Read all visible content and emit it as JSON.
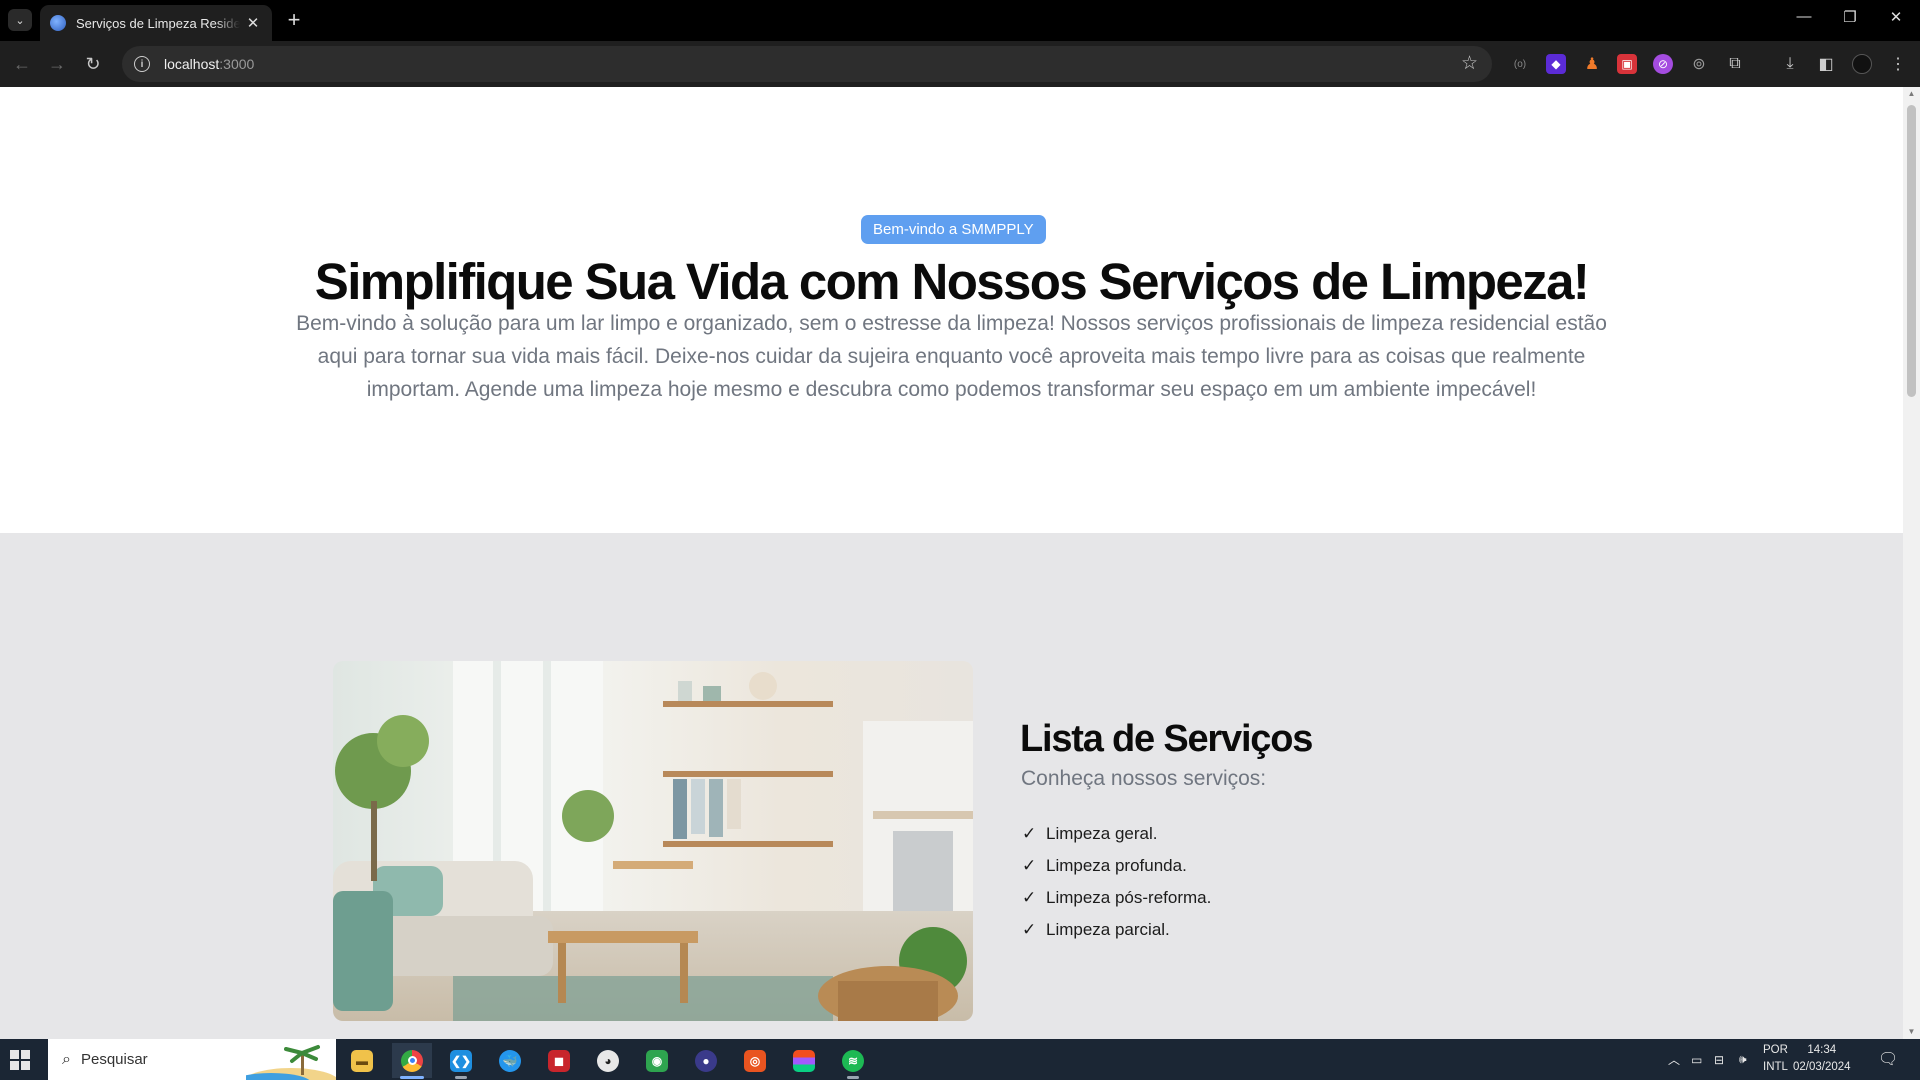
{
  "browser": {
    "tab_title": "Serviços de Limpeza Residencial",
    "url_host": "localhost",
    "url_port": ":3000"
  },
  "hero": {
    "badge": "Bem-vindo a SMMPPLY",
    "title": "Simplifique Sua Vida com Nossos Serviços de Limpeza!",
    "description": "Bem-vindo à solução para um lar limpo e organizado, sem o estresse da limpeza! Nossos serviços profissionais de limpeza residencial estão aqui para tornar sua vida mais fácil. Deixe-nos cuidar da sujeira enquanto você aproveita mais tempo livre para as coisas que realmente importam. Agende uma limpeza hoje mesmo e descubra como podemos transformar seu espaço em um ambiente impecável!"
  },
  "services": {
    "title": "Lista de Serviços",
    "subtitle": "Conheça nossos serviços:",
    "items": [
      "Limpeza geral.",
      "Limpeza profunda.",
      "Limpeza pós-reforma.",
      "Limpeza parcial."
    ]
  },
  "taskbar": {
    "search_placeholder": "Pesquisar",
    "language": "POR",
    "keyboard": "INTL",
    "time": "14:34",
    "date": "02/03/2024"
  },
  "colors": {
    "badge": "#5f9ff0",
    "section_bg": "#e6e6e8",
    "taskbar": "#1b2634"
  }
}
